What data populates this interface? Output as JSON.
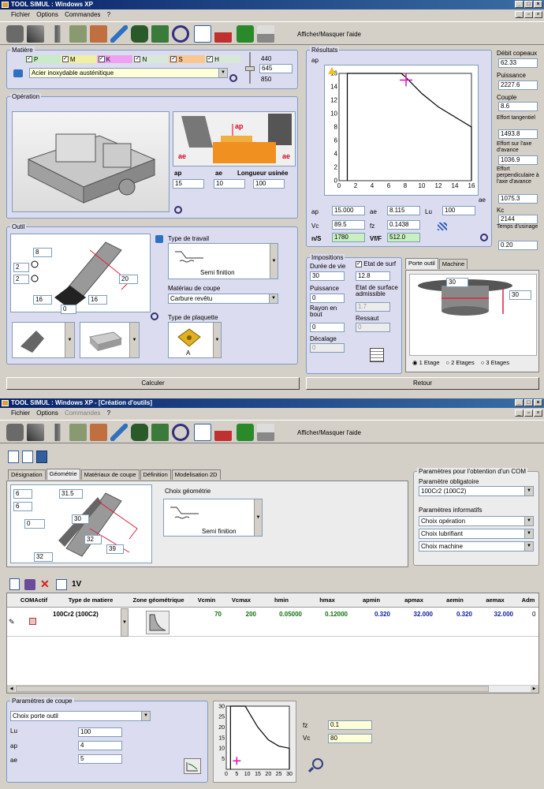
{
  "win1": {
    "title": "TOOL SIMUL : Windows XP",
    "menu": [
      "Fichier",
      "Options",
      "Commandes",
      "?"
    ],
    "toolbar_label": "Afficher/Masquer l'aide",
    "matiere": {
      "legend": "Matière",
      "flags": [
        {
          "code": "P",
          "color": "#c8ecc8"
        },
        {
          "code": "M",
          "color": "#f0f0a0"
        },
        {
          "code": "K",
          "color": "#f0a0f0"
        },
        {
          "code": "N",
          "color": "#d8e8d8"
        },
        {
          "code": "S",
          "color": "#f8c890"
        },
        {
          "code": "H",
          "color": "#d8e8d8"
        }
      ],
      "material": "Acier inoxydable austénitique",
      "hb_top": "440",
      "hb_value": "645",
      "hb_bottom": "850"
    },
    "operation": {
      "legend": "Opération",
      "ap_label": "ap",
      "ae_label": "ae",
      "lu_label": "Longueur usinée",
      "ap": "15",
      "ae": "10",
      "lu": "100",
      "diag_ap": "ap",
      "diag_ae1": "ae",
      "diag_ae2": "ae"
    },
    "outil": {
      "legend": "Outil",
      "dims": [
        "8",
        "2",
        "2",
        "20",
        "16",
        "16",
        "0"
      ],
      "type_travail_label": "Type de travail",
      "type_travail": "Semi finition",
      "materiau_label": "Matériau de coupe",
      "materiau": "Carbure revêtu",
      "plaquette_label": "Type de plaquette",
      "plaquette": "A"
    },
    "resultats": {
      "legend": "Résultats",
      "y_axis": "ap",
      "x_axis": "ae",
      "ap": "15.000",
      "ae": "8.115",
      "lu": "100",
      "vc": "89.5",
      "fz": "0.1438",
      "ns_label": "n/S",
      "ns": "1780",
      "vff_label": "Vf/F",
      "vff": "512.0",
      "ap_lbl": "ap",
      "ae_lbl": "ae",
      "lu_lbl": "Lu",
      "vc_lbl": "Vc",
      "fz_lbl": "fz"
    },
    "side": [
      {
        "label": "Débit copeaux",
        "value": "62.33"
      },
      {
        "label": "Puissance",
        "value": "2227.6"
      },
      {
        "label": "Couple",
        "value": "8.6"
      },
      {
        "label": "Effort tangentiel",
        "value": "1493.8"
      },
      {
        "label": "Effort sur l'axe d'avance",
        "value": "1036.9"
      },
      {
        "label": "Effort perpendiculaire à l'axe d'avance",
        "value": "1075.3"
      },
      {
        "label": "Kc",
        "value": "2144"
      },
      {
        "label": "Temps d'usinage",
        "value": "0.20"
      }
    ],
    "impositions": {
      "legend": "Impositions",
      "duree_label": "Durée de vie",
      "duree": "30",
      "etat_label": "Etat de surf",
      "etat": "12.8",
      "puissance_label": "Puissance",
      "puissance": "0",
      "etat_adm_label": "Etat de surface admissible",
      "etat_adm": "1.7",
      "rayon_label": "Rayon en bout",
      "rayon": "0",
      "ressaut_label": "Ressaut",
      "ressaut": "0",
      "decalage_label": "Décalage",
      "decalage": "0"
    },
    "porte": {
      "tabs": [
        "Porte outil",
        "Machine"
      ],
      "dim1": "30",
      "dim2": "30",
      "radios": [
        "1 Etage",
        "2 Etages",
        "3 Etages"
      ]
    },
    "calculer": "Calculer",
    "retour": "Retour"
  },
  "win2": {
    "title": "TOOL SIMUL : Windows XP - [Création d'outils]",
    "menu": [
      "Fichier",
      "Options",
      "Commandes",
      "?"
    ],
    "toolbar_label": "Afficher/Masquer l'aide",
    "tabs": [
      "Désignation",
      "Géométrie",
      "Matériaux de coupe",
      "Définition",
      "Modelisation 2D"
    ],
    "dims": [
      "6",
      "6",
      "31.5",
      "0",
      "30",
      "32",
      "32",
      "39"
    ],
    "choix_geo_label": "Choix géométrie",
    "choix_geo": "Semi finition",
    "com": {
      "legend": "Paramètres pour l'obtention d'un COM",
      "oblig_label": "Paramètre  obligatoire",
      "oblig": "100Cr2 (100C2)",
      "info_label": "Paramètres informatifs",
      "operation": "Choix opération",
      "lubrifiant": "Choix lubrifiant",
      "machine": "Choix machine"
    },
    "toolbar2_label": "1V",
    "grid": {
      "headers": [
        "COMActif",
        "Type de matiere",
        "Zone géométrique",
        "Vcmin",
        "Vcmax",
        "hmin",
        "hmax",
        "apmin",
        "apmax",
        "aemin",
        "aemax",
        "Adm"
      ],
      "row": {
        "type": "100Cr2 (100C2)",
        "vcmin": "70",
        "vcmax": "200",
        "hmin": "0.05000",
        "hmax": "0.12000",
        "apmin": "0.320",
        "apmax": "32.000",
        "aemin": "0.320",
        "aemax": "32.000",
        "adm": "0"
      }
    },
    "coupe": {
      "legend": "Paramètres de coupe",
      "porte": "Choix porte outil",
      "lu_label": "Lu",
      "lu": "100",
      "ap_label": "ap",
      "ap": "4",
      "ae_label": "ae",
      "ae": "5"
    },
    "fz_label": "fz",
    "fz": "0.1",
    "vc_label": "Vc",
    "vc": "80"
  },
  "chart_data": [
    {
      "type": "line",
      "title": "",
      "xlabel": "ae",
      "ylabel": "ap",
      "xlim": [
        0,
        16
      ],
      "ylim": [
        0,
        16
      ],
      "x_ticks": [
        "0",
        "2",
        "4",
        "6",
        "8",
        "10",
        "12",
        "14",
        "16"
      ],
      "y_ticks": [
        "0",
        "2",
        "4",
        "6",
        "8",
        "10",
        "12",
        "14",
        "16"
      ],
      "series": [
        {
          "x": [
            1,
            7.5,
            8,
            10,
            12,
            14,
            16
          ],
          "y": [
            16,
            16,
            15.5,
            13,
            11,
            9.5,
            8
          ]
        }
      ],
      "marker": {
        "x": 8.1,
        "y": 15
      }
    },
    {
      "type": "line",
      "title": "",
      "xlim": [
        0,
        30
      ],
      "ylim": [
        0,
        30
      ],
      "x_ticks": [
        "0",
        "5",
        "10",
        "15",
        "20",
        "25",
        "30"
      ],
      "y_ticks": [
        "5",
        "10",
        "15",
        "20",
        "25",
        "30"
      ],
      "series": [
        {
          "x": [
            2,
            9,
            12,
            15,
            20,
            25,
            30
          ],
          "y": [
            30,
            30,
            25,
            20,
            14,
            11,
            10
          ]
        }
      ],
      "marker": {
        "x": 5,
        "y": 4
      }
    }
  ]
}
